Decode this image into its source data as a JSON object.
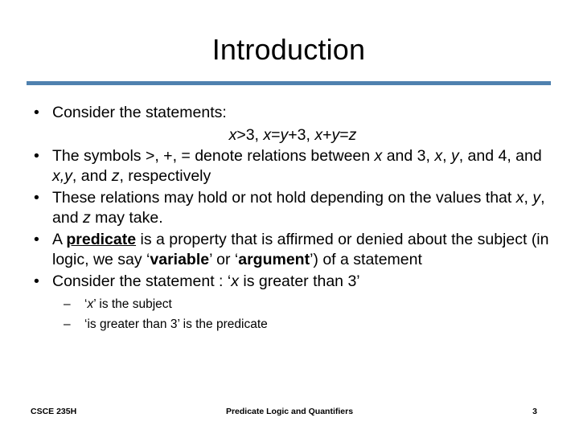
{
  "slide": {
    "title": "Introduction",
    "accent_color": "#4F81AF",
    "background_color": "#FFFFFF",
    "text_color": "#000000"
  },
  "bullets": {
    "marker": "•",
    "sub_marker": "–",
    "b1": {
      "text": "Consider the statements:",
      "math": {
        "v1": "x",
        "op1": ">3, ",
        "v2": "x",
        "op2": "=",
        "v3": "y",
        "op3": "+3, ",
        "v4": "x",
        "op4": "+",
        "v5": "y",
        "op5": "=",
        "v6": "z"
      }
    },
    "b2": {
      "p1": "The symbols >, +, = denote relations between ",
      "v1": "x",
      "p2": " and 3, ",
      "v2": "x",
      "p3": ", ",
      "v3": "y",
      "p4": ", and 4, and ",
      "v4": "x,y",
      "p5": ", and ",
      "v5": "z",
      "p6": ", respectively"
    },
    "b3": {
      "p1": "These relations may hold or not hold depending on the values that ",
      "v1": "x",
      "p2": ", ",
      "v2": "y",
      "p3": ", and ",
      "v3": "z",
      "p4": " may take."
    },
    "b4": {
      "p1": "A ",
      "key": "predicate",
      "p2": " is a property that is affirmed or denied about the subject (in logic, we say ‘",
      "term1": "variable",
      "p3": "’ or ‘",
      "term2": "argument",
      "p4": "’) of a statement"
    },
    "b5": {
      "p1": "Consider the statement : ‘",
      "v1": "x",
      "p2": " is greater than 3’"
    },
    "sub1": {
      "p1": "‘",
      "v1": "x",
      "p2": "’ is the subject"
    },
    "sub2": {
      "text": "‘is greater than 3’ is the predicate"
    }
  },
  "footer": {
    "course": "CSCE 235H",
    "topic": "Predicate Logic and Quantifiers",
    "page": "3"
  }
}
